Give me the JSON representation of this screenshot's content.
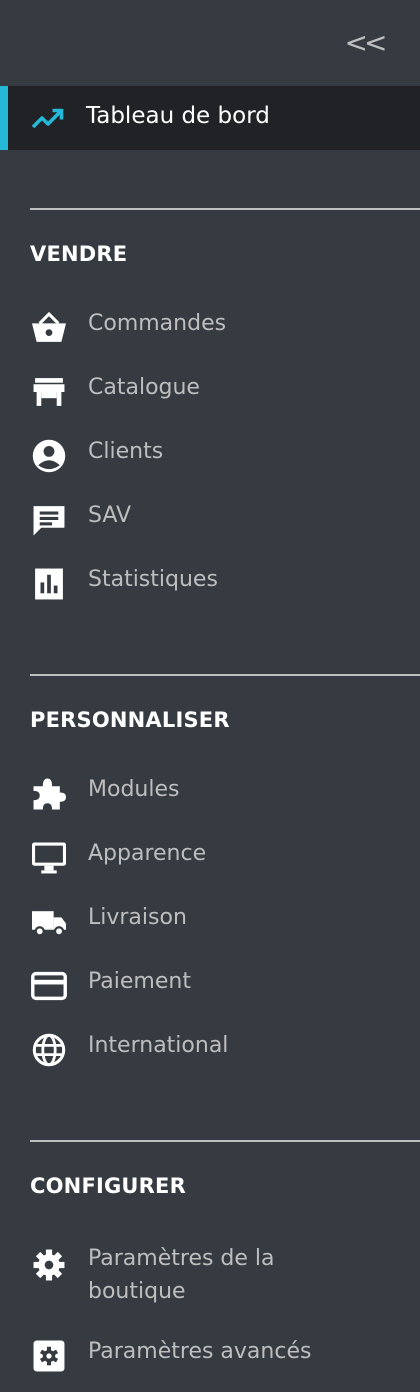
{
  "header": {
    "collapse_label": "<<"
  },
  "dashboard": {
    "label": "Tableau de bord",
    "icon": "trending-up-icon",
    "accent_color": "#25b9d7"
  },
  "sections": [
    {
      "title": "VENDRE",
      "items": [
        {
          "label": "Commandes",
          "icon": "basket-icon"
        },
        {
          "label": "Catalogue",
          "icon": "store-icon"
        },
        {
          "label": "Clients",
          "icon": "account-circle-icon"
        },
        {
          "label": "SAV",
          "icon": "chat-icon"
        },
        {
          "label": "Statistiques",
          "icon": "bar-chart-icon"
        }
      ]
    },
    {
      "title": "PERSONNALISER",
      "items": [
        {
          "label": "Modules",
          "icon": "puzzle-icon"
        },
        {
          "label": "Apparence",
          "icon": "desktop-icon"
        },
        {
          "label": "Livraison",
          "icon": "truck-icon"
        },
        {
          "label": "Paiement",
          "icon": "credit-card-icon"
        },
        {
          "label": "International",
          "icon": "globe-icon"
        }
      ]
    },
    {
      "title": "CONFIGURER",
      "items": [
        {
          "label": "Paramètres de la boutique",
          "icon": "gear-icon"
        },
        {
          "label": "Paramètres avancés",
          "icon": "settings-box-icon"
        }
      ]
    }
  ]
}
